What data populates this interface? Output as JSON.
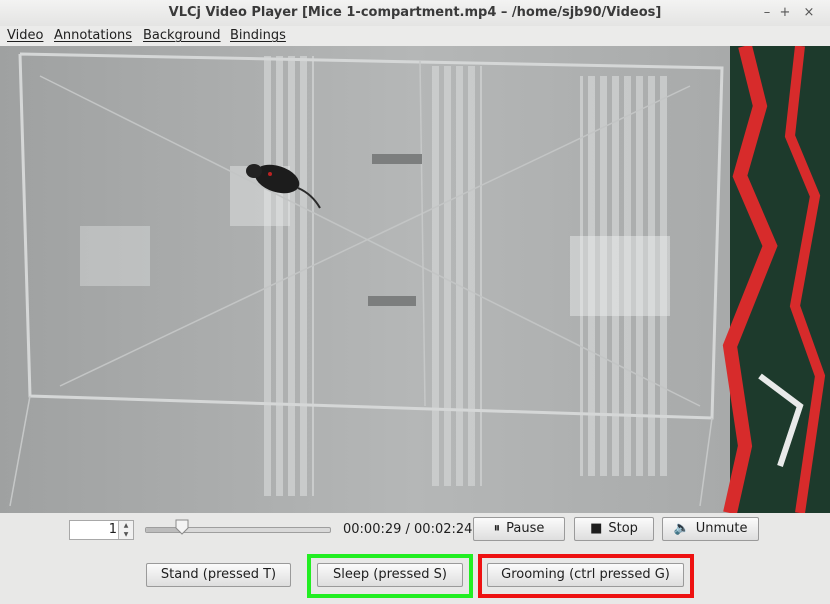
{
  "window": {
    "title": "VLCj Video Player [Mice 1-compartment.mp4 – /home/sjb90/Videos]",
    "minimize": "–",
    "maximize": "+",
    "close": "×"
  },
  "menu": [
    "Video",
    "Annotations",
    "Background",
    "Bindings"
  ],
  "player": {
    "rate": "1",
    "progress": 0.2,
    "time": "00:00:29 / 00:02:24",
    "pause_label": "Pause",
    "stop_label": "Stop",
    "unmute_label": "Unmute"
  },
  "behaviours": [
    {
      "label": "Stand (pressed T)",
      "highlight": ""
    },
    {
      "label": "Sleep (pressed S)",
      "highlight": "#22ee22"
    },
    {
      "label": "Grooming (ctrl pressed G)",
      "highlight": "#ee1111"
    }
  ]
}
